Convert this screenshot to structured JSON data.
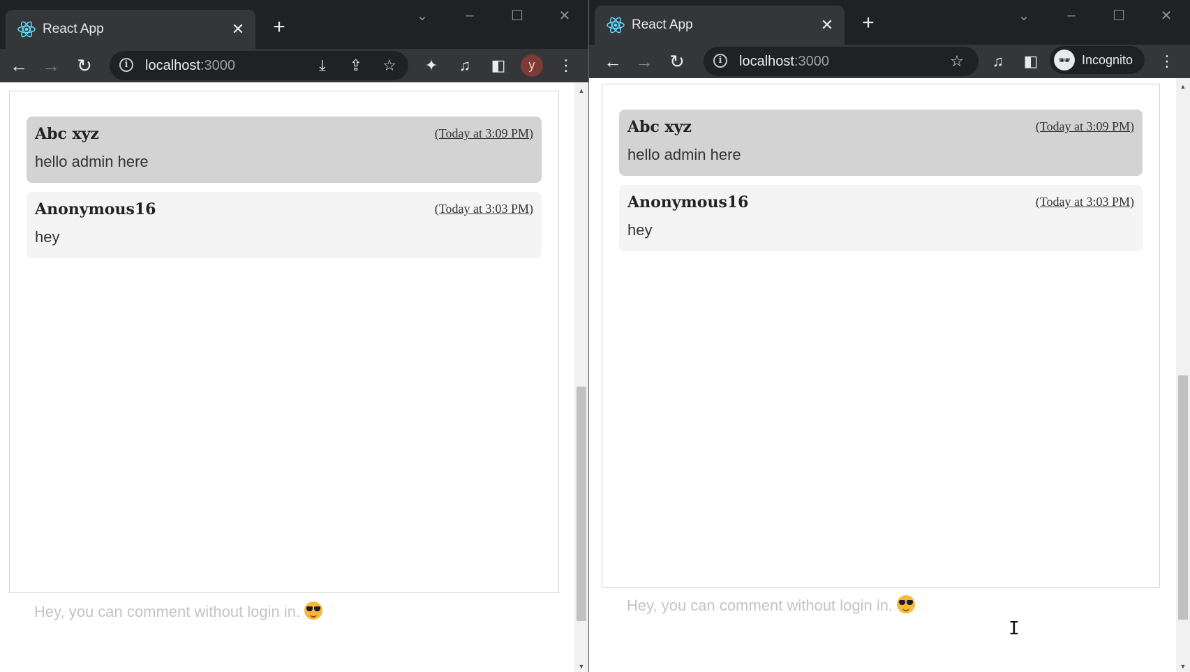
{
  "browser": {
    "tab_title": "React App",
    "url_host": "localhost",
    "url_port": ":3000",
    "profile_initial": "y",
    "incognito_label": "Incognito"
  },
  "comments": [
    {
      "author": "Abc xyz",
      "time": "(Today at 3:09 PM)",
      "text": "hello admin here",
      "highlighted": true
    },
    {
      "author": "Anonymous16",
      "time": "(Today at 3:03 PM)",
      "text": "hey",
      "highlighted": false
    }
  ],
  "input": {
    "placeholder": "Hey, you can comment without login in."
  },
  "colors": {
    "tabbar": "#202124",
    "toolbar": "#35363a",
    "highlighted_comment": "#d3d3d3",
    "normal_comment": "#f4f4f4",
    "placeholder": "#c4c4c4"
  }
}
